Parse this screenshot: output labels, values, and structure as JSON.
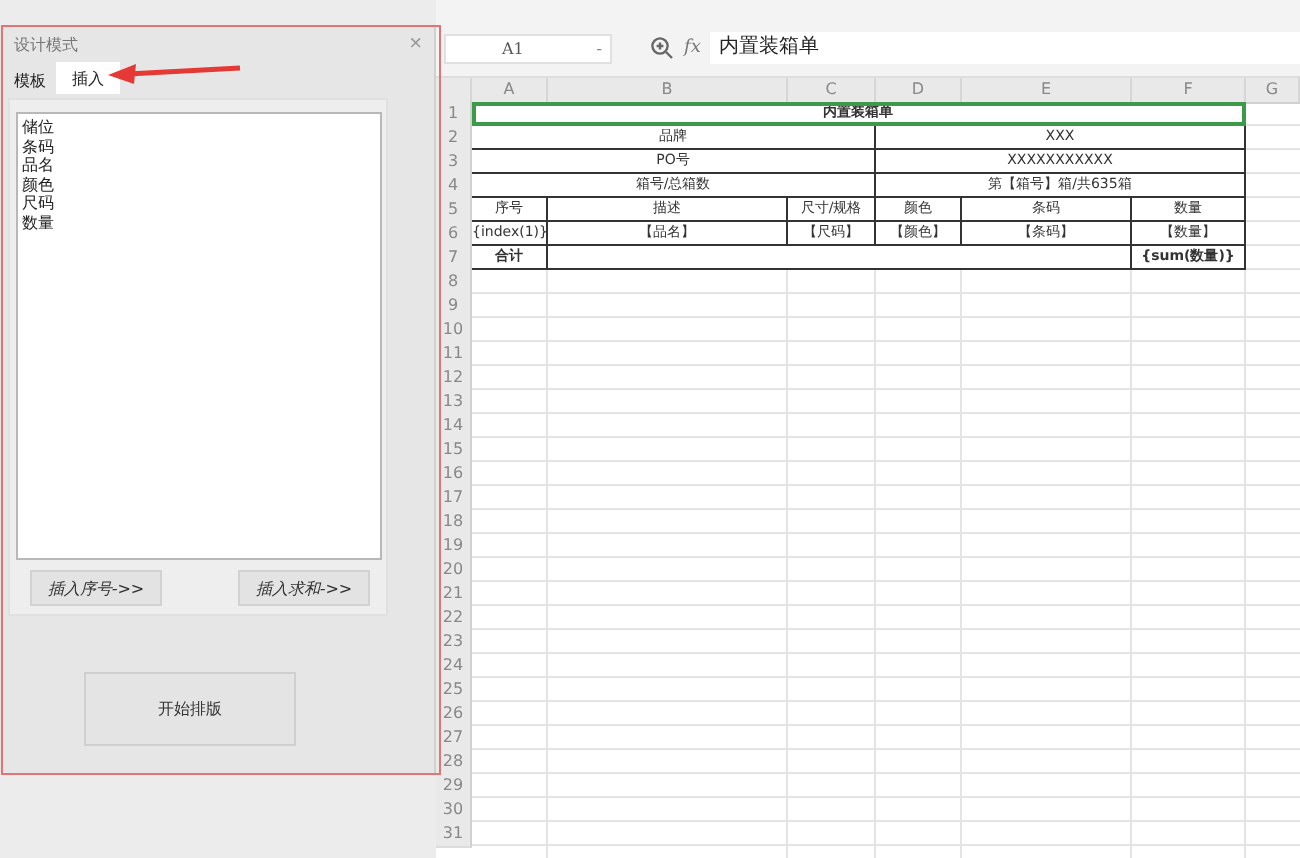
{
  "dialog": {
    "title": "设计模式",
    "close": "×",
    "tabs": [
      {
        "label": "模板",
        "selected": false
      },
      {
        "label": "插入",
        "selected": true
      }
    ],
    "fields": [
      "储位",
      "条码",
      "品名",
      "颜色",
      "尺码",
      "数量"
    ],
    "insert_buttons": [
      "插入序号->>",
      "插入求和->>"
    ],
    "start_button": "开始排版"
  },
  "formula_bar": {
    "cell": "A1",
    "dropdown": "-",
    "fx": "fx",
    "value": "内置装箱单"
  },
  "sheet": {
    "columns": [
      "A",
      "B",
      "C",
      "D",
      "E",
      "F",
      "G"
    ],
    "rows": [
      {
        "number": "1",
        "kind": "title",
        "cells": [
          {
            "text": "内置装箱单",
            "bold": true,
            "selected": true
          }
        ]
      },
      {
        "number": "2",
        "kind": "pair",
        "cells": [
          {
            "text": "品牌"
          },
          {
            "text": "XXX"
          }
        ]
      },
      {
        "number": "3",
        "kind": "pair",
        "cells": [
          {
            "text": "PO号"
          },
          {
            "text": "XXXXXXXXXXX"
          }
        ]
      },
      {
        "number": "4",
        "kind": "pair",
        "cells": [
          {
            "text": "箱号/总箱数"
          },
          {
            "text": "第【箱号】箱/共635箱"
          }
        ]
      },
      {
        "number": "5",
        "kind": "detail",
        "cells": [
          {
            "text": "序号"
          },
          {
            "text": "描述"
          },
          {
            "text": "尺寸/规格"
          },
          {
            "text": "颜色"
          },
          {
            "text": "条码"
          },
          {
            "text": "数量"
          }
        ]
      },
      {
        "number": "6",
        "kind": "detail",
        "cells": [
          {
            "text": "{index(1)}"
          },
          {
            "text": "【品名】"
          },
          {
            "text": "【尺码】"
          },
          {
            "text": "【颜色】"
          },
          {
            "text": "【条码】"
          },
          {
            "text": "【数量】"
          }
        ]
      },
      {
        "number": "7",
        "kind": "total",
        "cells": [
          {
            "text": "合计",
            "bold": true
          },
          {},
          {
            "text": "{sum(数量)}",
            "bold": true
          }
        ]
      },
      {
        "number": "8"
      },
      {
        "number": "9"
      },
      {
        "number": "10"
      },
      {
        "number": "11"
      },
      {
        "number": "12"
      },
      {
        "number": "13"
      },
      {
        "number": "14"
      },
      {
        "number": "15"
      },
      {
        "number": "16"
      },
      {
        "number": "17"
      },
      {
        "number": "18"
      },
      {
        "number": "19"
      },
      {
        "number": "20"
      },
      {
        "number": "21"
      },
      {
        "number": "22"
      },
      {
        "number": "23"
      },
      {
        "number": "24"
      },
      {
        "number": "25"
      },
      {
        "number": "26"
      },
      {
        "number": "27"
      },
      {
        "number": "28"
      },
      {
        "number": "29"
      },
      {
        "number": "30"
      },
      {
        "number": "31"
      }
    ]
  }
}
